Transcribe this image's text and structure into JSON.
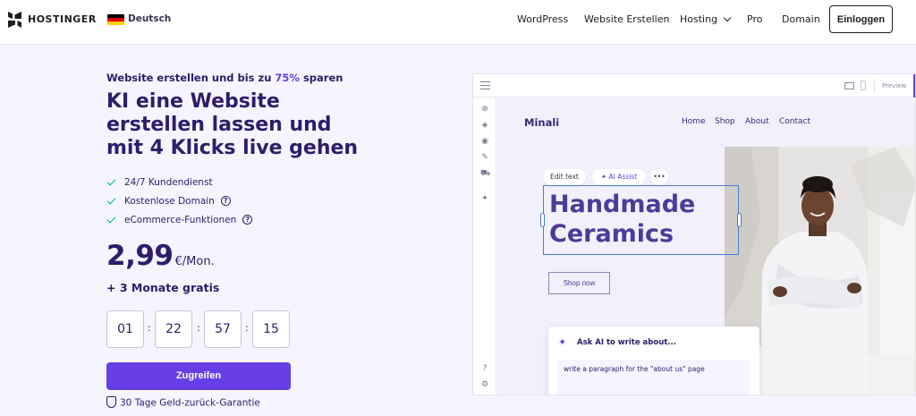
{
  "nav": {
    "brand": "HOSTINGER",
    "language": "Deutsch",
    "links": [
      "WordPress",
      "Website Erstellen",
      "Hosting",
      "Pro",
      "Domain"
    ],
    "login": "Einloggen"
  },
  "hero": {
    "promo_prefix": "Website erstellen und bis zu ",
    "promo_highlight": "75%",
    "promo_suffix": " sparen",
    "headline": "KI eine Website erstellen lassen und mit 4 Klicks live gehen",
    "features": [
      "24/7 Kundendienst",
      "Kostenlose Domain",
      "eCommerce-Funktionen"
    ],
    "price": "2,99",
    "price_unit": "€/Mon.",
    "bonus": "+ 3 Monate gratis",
    "timer": [
      "01",
      "22",
      "57",
      "15"
    ],
    "cta": "Zugreifen",
    "guarantee": "30 Tage Geld-zurück-Garantie"
  },
  "editor": {
    "preview": "Preview",
    "site_logo": "Minali",
    "site_nav": [
      "Home",
      "Shop",
      "About",
      "Contact"
    ],
    "toolbar": {
      "edit": "Edit text",
      "ai": "AI Assist",
      "more": "•••"
    },
    "title_line1": "Handmade",
    "title_line2": "Ceramics",
    "shop_button": "Shop now",
    "ai_title": "Ask AI to write about...",
    "ai_prompt": "write a paragraph for the \"about us\" page"
  },
  "colors": {
    "accent": "#673de6",
    "navy": "#2f1c6a",
    "check": "#00b090"
  }
}
